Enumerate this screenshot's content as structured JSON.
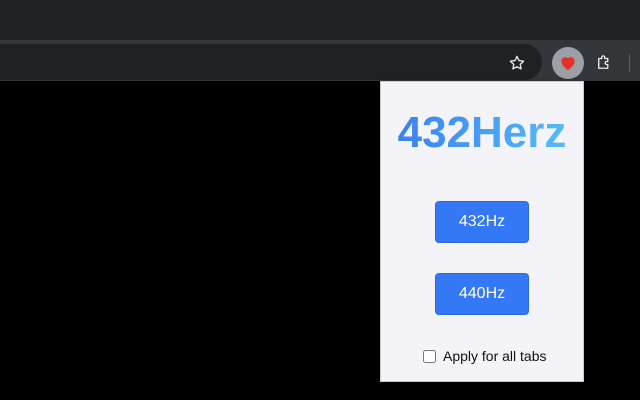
{
  "browser": {
    "toolbar": {
      "bookmark_icon": "star-outline-icon",
      "extension_icon": "heart-icon",
      "extension_color": "#e8302a",
      "extensions_menu_icon": "puzzle-icon"
    }
  },
  "popup": {
    "title": "432Herz",
    "title_gradient": [
      "#3a7bef",
      "#5ac1f7"
    ],
    "buttons": {
      "hz432_label": "432Hz",
      "hz440_label": "440Hz",
      "button_color": "#3478f6"
    },
    "apply_all": {
      "label": "Apply for all tabs",
      "checked": false
    }
  }
}
